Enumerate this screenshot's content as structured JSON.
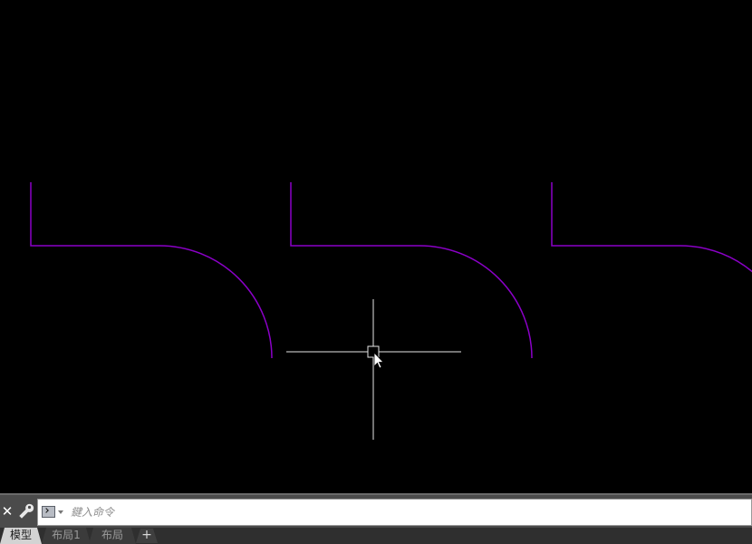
{
  "canvas": {
    "background": "#000000",
    "linework_color": "#8b00c8",
    "crosshair_color": "#e6e6e6",
    "cursor": "arrow-cursor-icon"
  },
  "command_line": {
    "close_label": "✕",
    "settings_icon": "wrench-icon",
    "prompt_icon": "command-prompt-icon",
    "placeholder": "鍵入命令",
    "value": ""
  },
  "layout_tabs": {
    "tabs": [
      {
        "label": "模型",
        "active": true
      },
      {
        "label": "布局1",
        "active": false
      },
      {
        "label": "布局",
        "active": false
      }
    ],
    "add_label": "+"
  }
}
